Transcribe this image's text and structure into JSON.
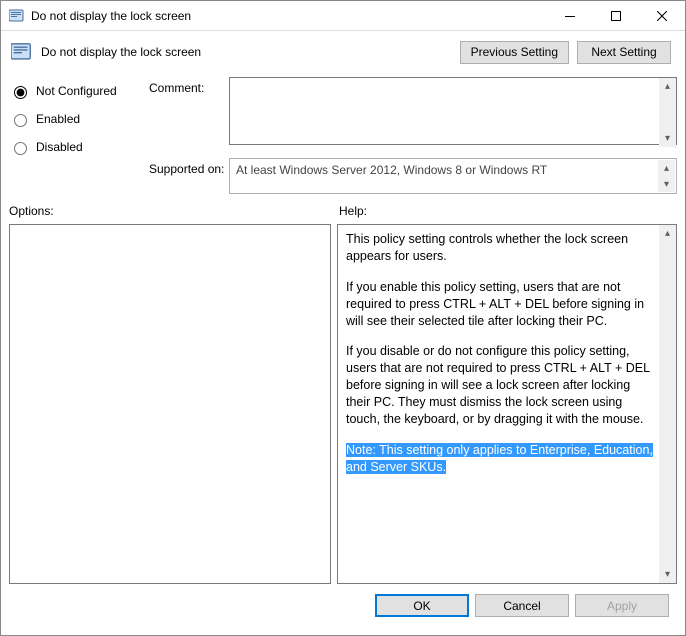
{
  "title": "Do not display the lock screen",
  "header": {
    "setting_name": "Do not display the lock screen",
    "prev": "Previous Setting",
    "next": "Next Setting"
  },
  "states": {
    "not_configured": "Not Configured",
    "enabled": "Enabled",
    "disabled": "Disabled",
    "selected": "not_configured"
  },
  "comment": {
    "label": "Comment:",
    "value": ""
  },
  "supported": {
    "label": "Supported on:",
    "value": "At least Windows Server 2012, Windows 8 or Windows RT"
  },
  "labels": {
    "options": "Options:",
    "help": "Help:"
  },
  "help": {
    "p1": "This policy setting controls whether the lock screen appears for users.",
    "p2": "If you enable this policy setting, users that are not required to press CTRL + ALT + DEL before signing in will see their selected tile after locking their PC.",
    "p3": "If you disable or do not configure this policy setting, users that are not required to press CTRL + ALT + DEL before signing in will see a lock screen after locking their PC. They must dismiss the lock screen using touch, the keyboard, or by dragging it with the mouse.",
    "p4": "Note: This setting only applies to Enterprise, Education, and Server SKUs."
  },
  "footer": {
    "ok": "OK",
    "cancel": "Cancel",
    "apply": "Apply"
  }
}
